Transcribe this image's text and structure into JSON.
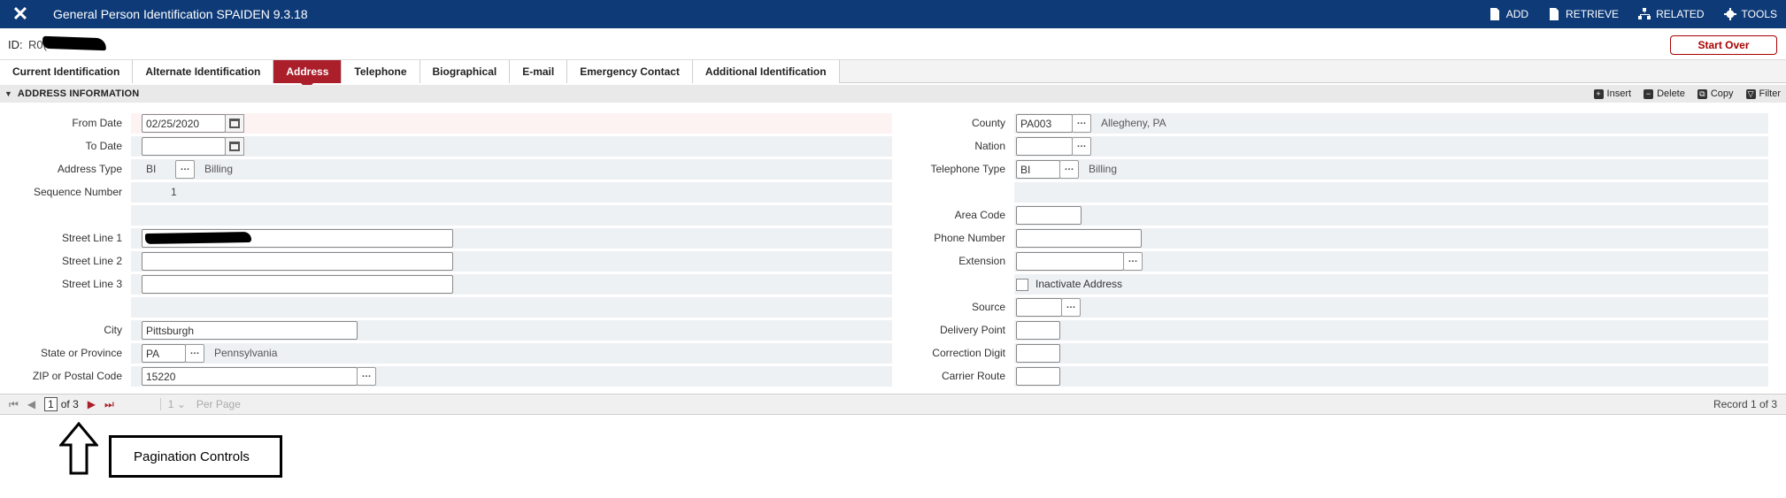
{
  "app": {
    "title": "General Person Identification SPAIDEN 9.3.18",
    "actions": [
      {
        "label": "ADD",
        "icon": "add-doc-icon"
      },
      {
        "label": "RETRIEVE",
        "icon": "retrieve-icon"
      },
      {
        "label": "RELATED",
        "icon": "related-icon"
      },
      {
        "label": "TOOLS",
        "icon": "gear-icon"
      }
    ]
  },
  "header": {
    "id_label": "ID:",
    "id_value": "R0(",
    "start_over": "Start Over"
  },
  "tabs": [
    {
      "label": "Current Identification",
      "active": false
    },
    {
      "label": "Alternate Identification",
      "active": false
    },
    {
      "label": "Address",
      "active": true
    },
    {
      "label": "Telephone",
      "active": false
    },
    {
      "label": "Biographical",
      "active": false
    },
    {
      "label": "E-mail",
      "active": false
    },
    {
      "label": "Emergency Contact",
      "active": false
    },
    {
      "label": "Additional Identification",
      "active": false
    }
  ],
  "section": {
    "title": "ADDRESS INFORMATION",
    "tools": [
      {
        "label": "Insert",
        "icon": "insert-icon"
      },
      {
        "label": "Delete",
        "icon": "delete-icon"
      },
      {
        "label": "Copy",
        "icon": "copy-icon"
      },
      {
        "label": "Filter",
        "icon": "filter-icon"
      }
    ]
  },
  "left": {
    "from_date": {
      "label": "From Date",
      "value": "02/25/2020"
    },
    "to_date": {
      "label": "To Date",
      "value": ""
    },
    "address_type": {
      "label": "Address Type",
      "value": "BI",
      "desc": "Billing"
    },
    "sequence": {
      "label": "Sequence Number",
      "value": "1"
    },
    "street1": {
      "label": "Street Line 1",
      "value": ""
    },
    "street2": {
      "label": "Street Line 2",
      "value": ""
    },
    "street3": {
      "label": "Street Line 3",
      "value": ""
    },
    "city": {
      "label": "City",
      "value": "Pittsburgh"
    },
    "state": {
      "label": "State or Province",
      "value": "PA",
      "desc": "Pennsylvania"
    },
    "zip": {
      "label": "ZIP or Postal Code",
      "value": "15220"
    }
  },
  "right": {
    "county": {
      "label": "County",
      "value": "PA003",
      "desc": "Allegheny, PA"
    },
    "nation": {
      "label": "Nation",
      "value": ""
    },
    "tel_type": {
      "label": "Telephone Type",
      "value": "BI",
      "desc": "Billing"
    },
    "area_code": {
      "label": "Area Code",
      "value": ""
    },
    "phone": {
      "label": "Phone Number",
      "value": ""
    },
    "extension": {
      "label": "Extension",
      "value": ""
    },
    "inactivate": {
      "label": "Inactivate Address",
      "checked": false
    },
    "source": {
      "label": "Source",
      "value": ""
    },
    "delivery": {
      "label": "Delivery Point",
      "value": ""
    },
    "correction": {
      "label": "Correction Digit",
      "value": ""
    },
    "carrier": {
      "label": "Carrier Route",
      "value": ""
    }
  },
  "pager": {
    "page": "1",
    "of_label": "of 3",
    "per_page_value": "1",
    "per_page_label": "Per Page",
    "record": "Record 1 of 3"
  },
  "annotation": {
    "callout": "Pagination Controls"
  }
}
